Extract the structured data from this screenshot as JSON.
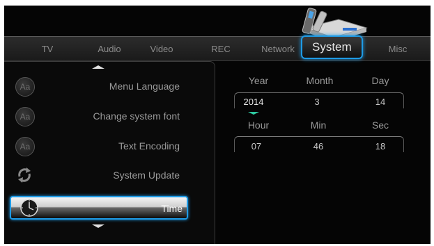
{
  "tabs": [
    {
      "label": "TV"
    },
    {
      "label": "Audio"
    },
    {
      "label": "Video"
    },
    {
      "label": "REC"
    },
    {
      "label": "Network"
    },
    {
      "label": "System"
    },
    {
      "label": "Misc"
    }
  ],
  "active_tab": "System",
  "menu": {
    "items": [
      {
        "label": "Menu Language",
        "icon": "font-aa-icon"
      },
      {
        "label": "Change system font",
        "icon": "font-aa-icon"
      },
      {
        "label": "Text Encoding",
        "icon": "font-aa-icon"
      },
      {
        "label": "System Update",
        "icon": "refresh-icon"
      },
      {
        "label": "Time",
        "icon": "clock-icon"
      }
    ],
    "selected": "Time",
    "icon_text": "Aa"
  },
  "time_settings": {
    "date_headers": {
      "year": "Year",
      "month": "Month",
      "day": "Day"
    },
    "date_values": {
      "year": "2014",
      "month": "3",
      "day": "14"
    },
    "time_headers": {
      "hour": "Hour",
      "min": "Min",
      "sec": "Sec"
    },
    "time_values": {
      "hour": "07",
      "min": "46",
      "sec": "18"
    }
  },
  "colors": {
    "highlight": "#1e9be6",
    "spinner": "#2ec8a0",
    "background": "#050505"
  }
}
